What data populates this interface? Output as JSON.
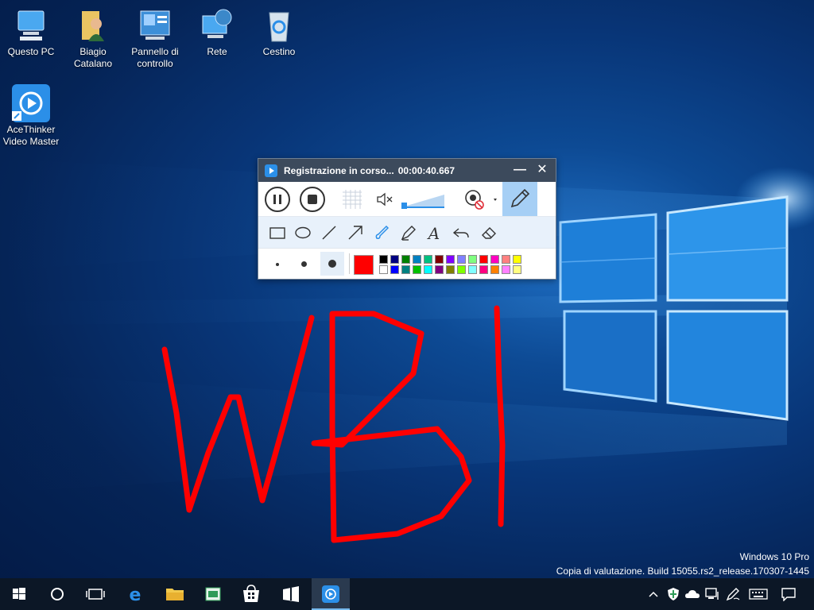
{
  "desktop": {
    "icons": [
      {
        "label": "Questo PC",
        "icon": "computer-icon"
      },
      {
        "label": "Biagio\nCatalano",
        "icon": "user-folder-icon"
      },
      {
        "label": "Pannello di\ncontrollo",
        "icon": "control-panel-icon"
      },
      {
        "label": "Rete",
        "icon": "network-icon"
      },
      {
        "label": "Cestino",
        "icon": "recycle-bin-icon"
      },
      {
        "label": "AceThinker\nVideo Master",
        "icon": "acethinker-icon"
      }
    ],
    "annotation_text": "WBI",
    "annotation_color": "#ff0000"
  },
  "watermark": {
    "line1": "Windows 10 Pro",
    "line2": "Copia di valutazione. Build 15055.rs2_release.170307-1445"
  },
  "recorder": {
    "title": "Registrazione in corso...",
    "elapsed": "00:00:40.667",
    "minimize": "—",
    "close": "✕",
    "selected_color": "#ff0000",
    "palette": [
      [
        "#000000",
        "#000080",
        "#008000",
        "#0080c0",
        "#00c080",
        "#800000",
        "#8000ff",
        "#8080ff",
        "#80ff80",
        "#ff0000",
        "#ff00c0",
        "#ff8080",
        "#ffff00"
      ],
      [
        "#ffffff",
        "#0000ff",
        "#008080",
        "#00c000",
        "#00ffff",
        "#800080",
        "#808000",
        "#80ff00",
        "#80ffff",
        "#ff0080",
        "#ff8000",
        "#ff80ff",
        "#ffff80"
      ]
    ]
  },
  "taskbar": {
    "items": [
      "windows-start-icon",
      "cortana-icon",
      "task-view-icon",
      "edge-icon",
      "file-explorer-icon",
      "store-app-icon",
      "windows-store-icon",
      "media-player-icon",
      "acethinker-taskbar-icon"
    ],
    "tray": [
      "chevron-up-icon",
      "defender-icon",
      "onedrive-icon",
      "network-tray-icon",
      "pen-icon",
      "keyboard-icon",
      "notification-icon"
    ]
  }
}
